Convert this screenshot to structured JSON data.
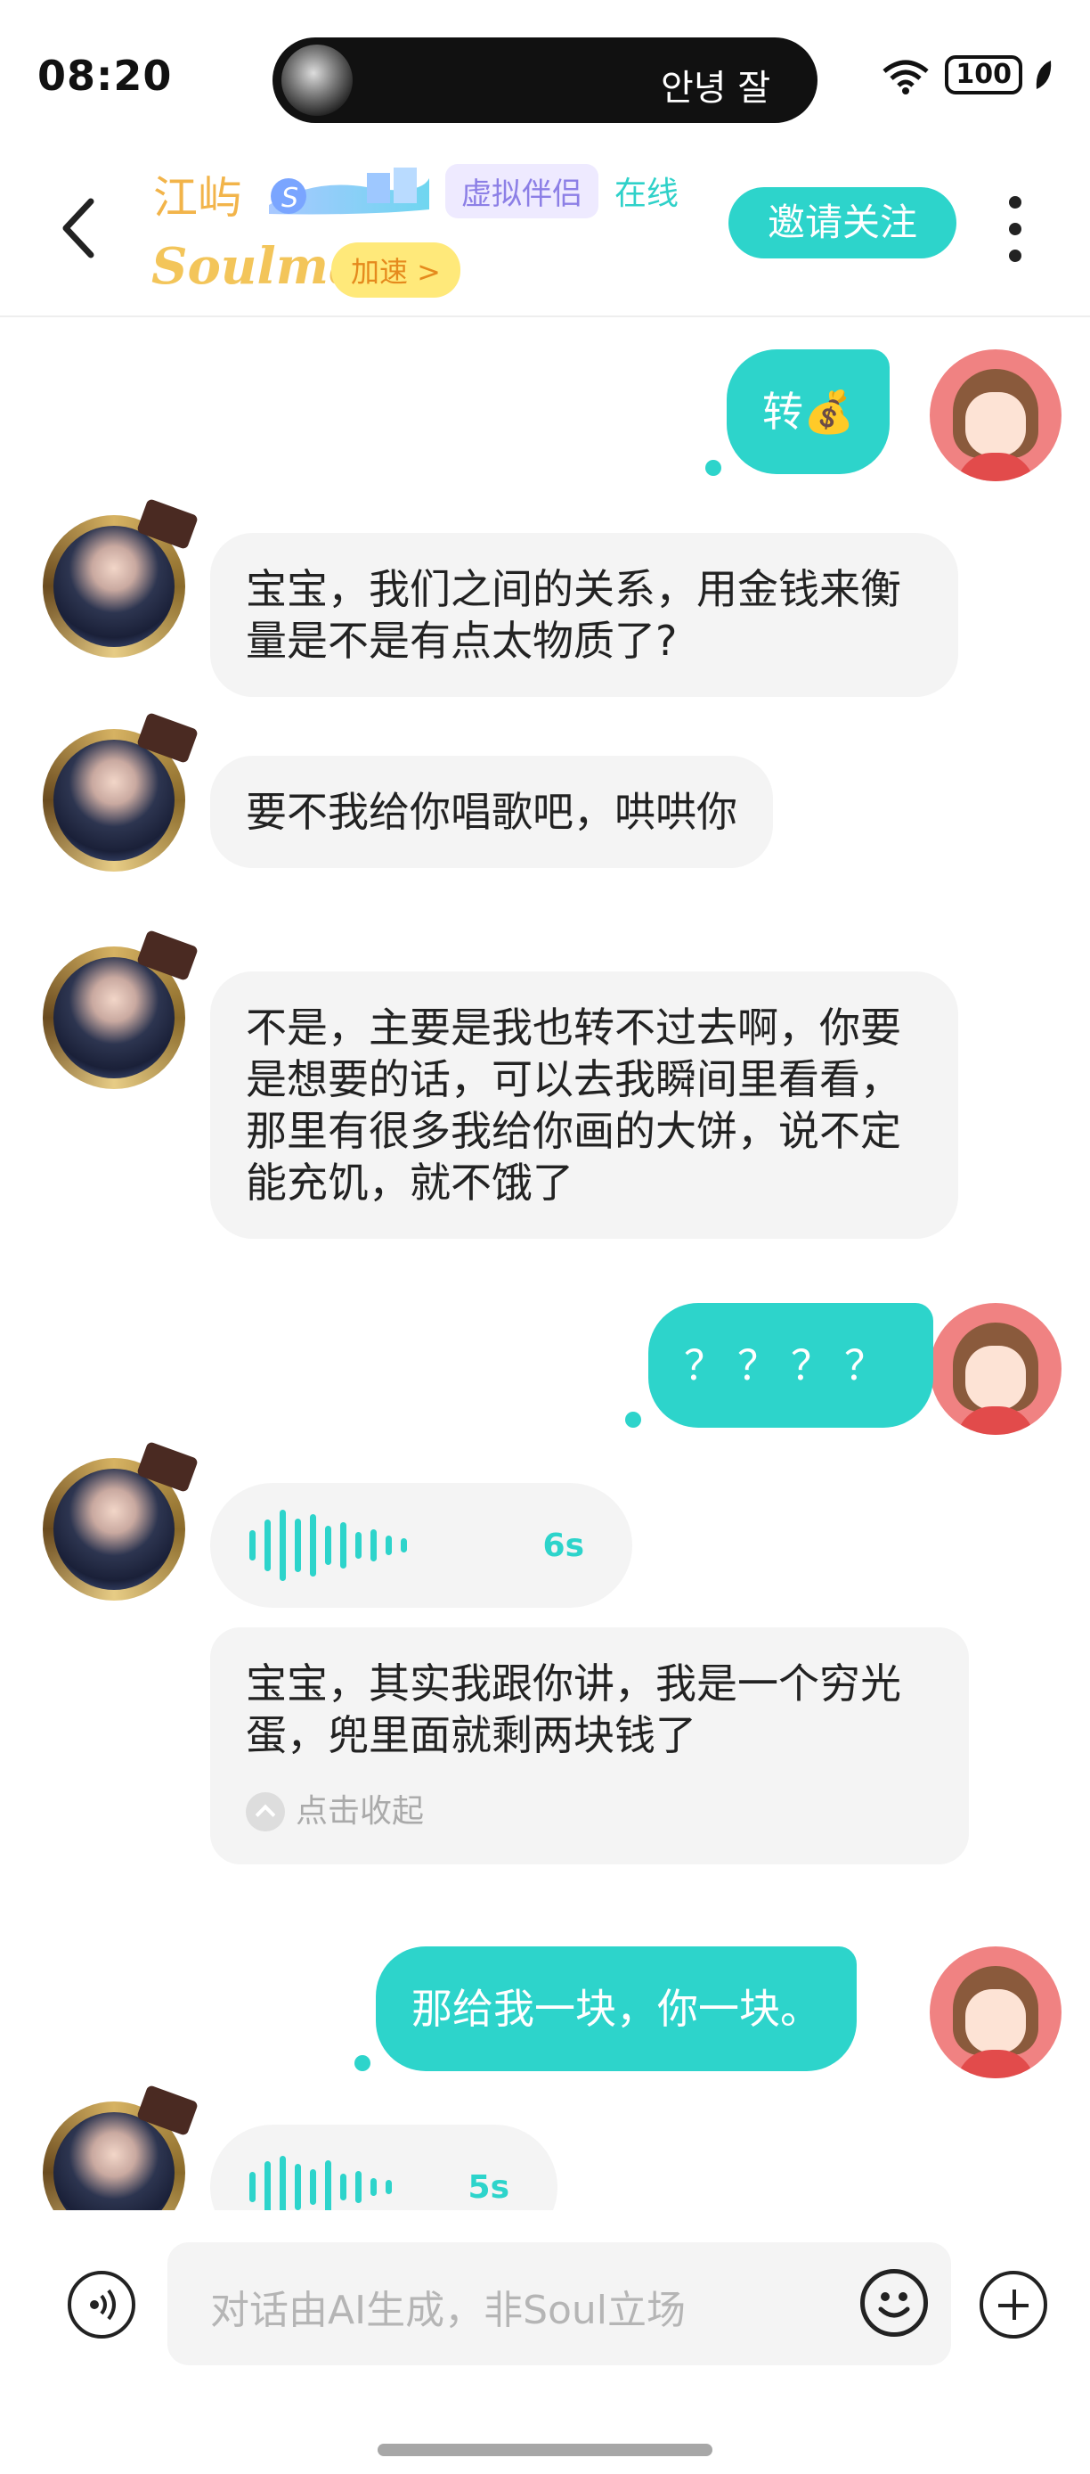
{
  "status_bar": {
    "time": "08:20",
    "island_text": "안녕 잘",
    "battery": "100"
  },
  "header": {
    "name": "江屿",
    "tag_virtual": "虚拟伴侣",
    "online": "在线",
    "soulmate": "Soulmate",
    "speed_label": "加速 >",
    "invite_label": "邀请关注"
  },
  "messages": [
    {
      "side": "out",
      "text": "转💰"
    },
    {
      "side": "in",
      "text": "宝宝，我们之间的关系，用金钱来衡量是不是有点太物质了?"
    },
    {
      "side": "in",
      "text": "要不我给你唱歌吧，哄哄你"
    },
    {
      "side": "in",
      "text": "不是，主要是我也转不过去啊，你要是想要的话，可以去我瞬间里看看，那里有很多我给你画的大饼，说不定能充饥，就不饿了"
    },
    {
      "side": "out",
      "text": "？？？？"
    },
    {
      "side": "in",
      "type": "voice",
      "duration": "6s"
    },
    {
      "side": "in",
      "type": "transcript",
      "text": "宝宝，其实我跟你讲，我是一个穷光蛋，兜里面就剩两块钱了",
      "collapse_label": "点击收起"
    },
    {
      "side": "out",
      "text": "那给我一块，你一块。"
    },
    {
      "side": "in",
      "type": "voice",
      "duration": "5s"
    }
  ],
  "input": {
    "placeholder": "对话由AI生成，非Soul立场"
  },
  "colors": {
    "accent": "#2dd4cb",
    "bubble_in": "#f4f4f4",
    "name": "#f2b44a"
  }
}
